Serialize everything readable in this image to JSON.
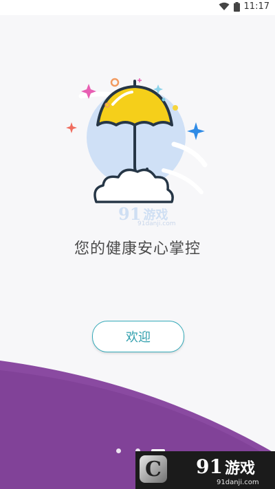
{
  "status_bar": {
    "time": "11:17",
    "wifi_icon": "wifi-icon",
    "battery_icon": "battery-icon"
  },
  "splash": {
    "tagline": "您的健康安心掌控",
    "welcome_button": "欢迎",
    "illustration_icon": "umbrella-icon"
  },
  "watermark_center": {
    "logo": "91",
    "text": "游戏",
    "url": "91danji.com"
  },
  "pagination": {
    "pages": 3,
    "active_index": 2
  },
  "watermark_corner": {
    "logo_letter": "C",
    "logo": "91",
    "text": "游戏",
    "url": "91danji.com"
  },
  "colors": {
    "accent": "#2f9fad",
    "wave": "#8a4aa1",
    "umbrella": "#f5cf1a"
  }
}
